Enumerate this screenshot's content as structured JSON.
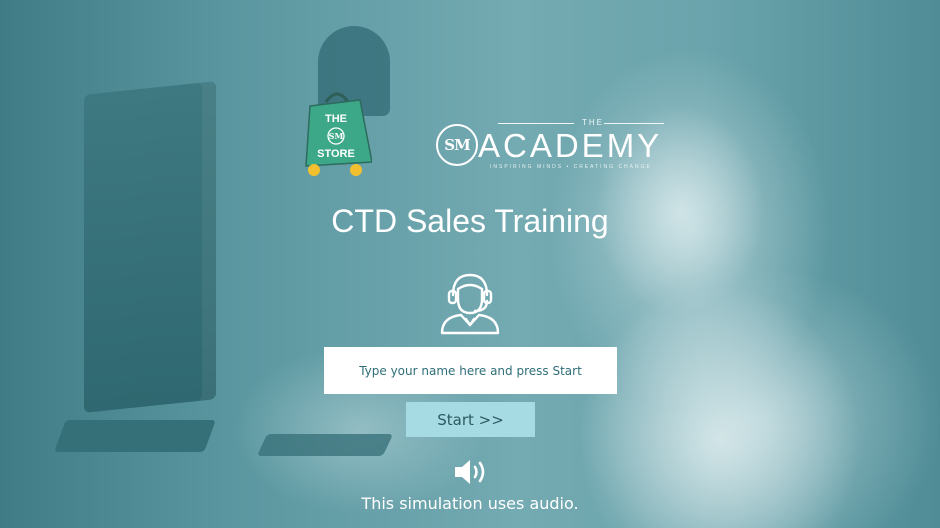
{
  "branding": {
    "store_logo": {
      "line1": "THE",
      "line2": "SM",
      "line3": "STORE",
      "bag_color": "#3da887"
    },
    "academy_logo": {
      "the": "THE",
      "monogram": "SM",
      "word": "ACADEMY",
      "tagline": "INSPIRING MINDS • CREATING CHANGE"
    }
  },
  "title": "CTD Sales Training",
  "name_input": {
    "placeholder": "Type your name here and press Start",
    "value": ""
  },
  "start_button": {
    "label": "Start >>"
  },
  "audio_notice": "This simulation uses audio.",
  "icons": {
    "agent": "customer-service-agent-icon",
    "audio": "speaker-icon"
  },
  "colors": {
    "overlay": "#5f9aa3",
    "button_bg": "#a7dbe3",
    "button_text": "#2b5a61",
    "input_text": "#2f6e78"
  }
}
